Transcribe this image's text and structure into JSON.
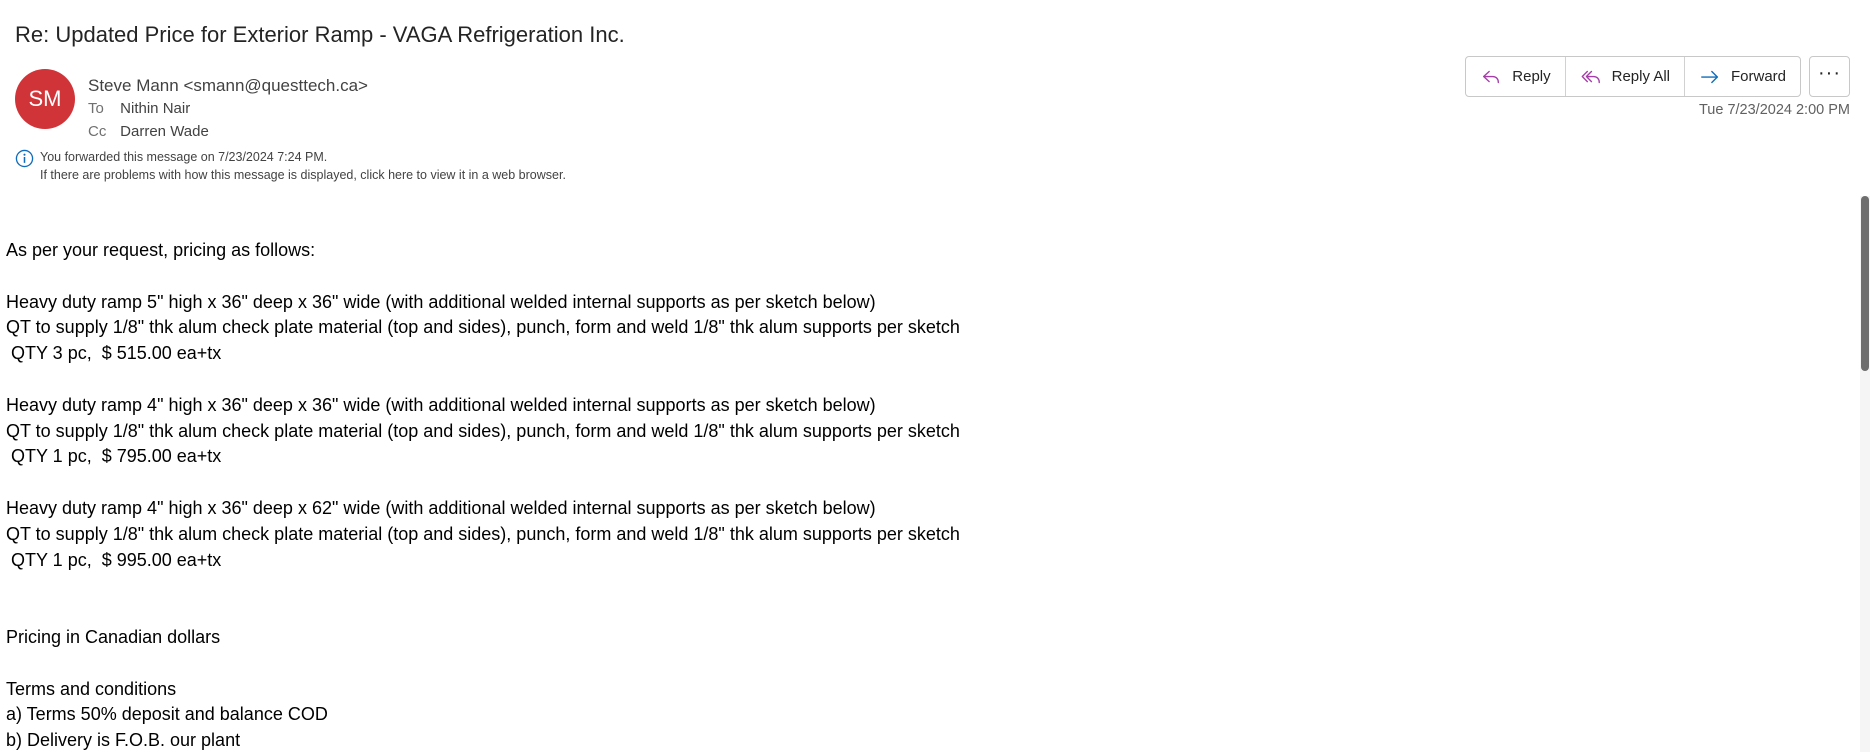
{
  "email": {
    "subject": "Re: Updated Price for Exterior Ramp - VAGA Refrigeration Inc.",
    "sender_initials": "SM",
    "sender": "Steve  Mann <smann@questtech.ca>",
    "to_label": "To",
    "to_value": "Nithin Nair",
    "cc_label": "Cc",
    "cc_value": "Darren Wade",
    "info_forwarded": "You forwarded this message on 7/23/2024 7:24 PM.",
    "info_browser": "If there are problems with how this message is displayed, click here to view it in a web browser.",
    "timestamp": "Tue 7/23/2024 2:00 PM"
  },
  "actions": {
    "reply": "Reply",
    "reply_all": "Reply All",
    "forward": "Forward",
    "more": "···"
  },
  "body_lines": [
    "As per your request, pricing as follows:",
    "",
    "Heavy duty ramp 5\" high x 36\" deep x 36\" wide (with additional welded internal supports as per sketch below)",
    "QT to supply 1/8\" thk alum check plate material (top and sides), punch, form and weld 1/8\" thk alum supports per sketch",
    " QTY 3 pc,  $ 515.00 ea+tx",
    "",
    "Heavy duty ramp 4\" high x 36\" deep x 36\" wide (with additional welded internal supports as per sketch below)",
    "QT to supply 1/8\" thk alum check plate material (top and sides), punch, form and weld 1/8\" thk alum supports per sketch",
    " QTY 1 pc,  $ 795.00 ea+tx",
    "",
    "Heavy duty ramp 4\" high x 36\" deep x 62\" wide (with additional welded internal supports as per sketch below)",
    "QT to supply 1/8\" thk alum check plate material (top and sides), punch, form and weld 1/8\" thk alum supports per sketch",
    " QTY 1 pc,  $ 995.00 ea+tx",
    "",
    "",
    "Pricing in Canadian dollars",
    "",
    "Terms and conditions",
    "a) Terms 50% deposit and balance COD",
    "b) Delivery is F.O.B. our plant"
  ],
  "colors": {
    "avatar_bg": "#d13438",
    "reply_icon": "#a43fa8",
    "forward_icon": "#0f6cbd",
    "info_icon": "#0f6cbd"
  },
  "icons": {
    "reply": "reply-arrow-icon",
    "reply_all": "reply-all-arrow-icon",
    "forward": "forward-arrow-icon",
    "more": "ellipsis-icon",
    "info": "info-circle-icon"
  }
}
